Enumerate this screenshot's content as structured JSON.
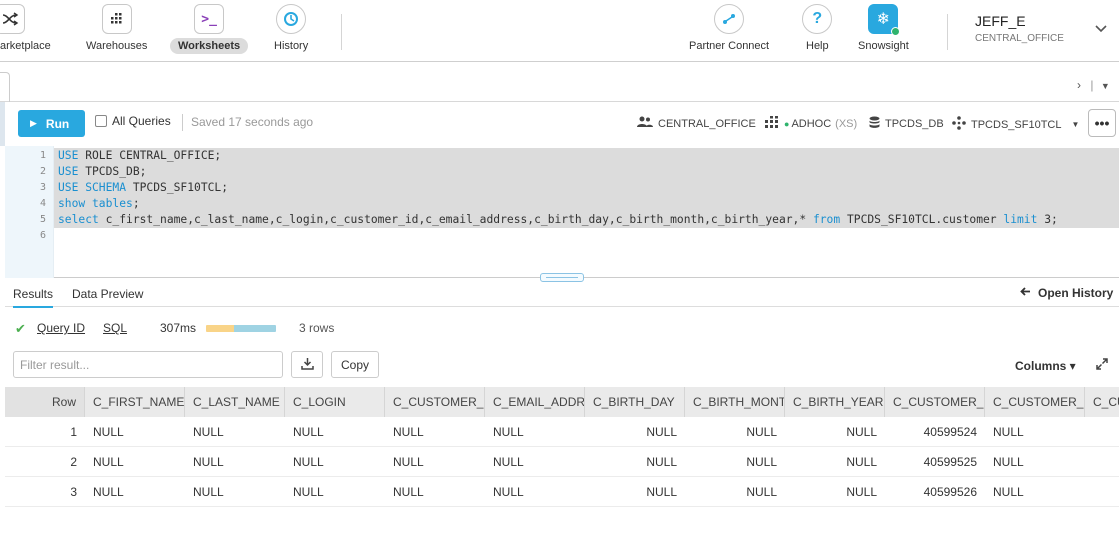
{
  "nav": {
    "items": [
      {
        "label": "arketplace",
        "icon": "marketplace-icon"
      },
      {
        "label": "Warehouses",
        "icon": "warehouses-icon"
      },
      {
        "label": "Worksheets",
        "icon": "worksheets-icon",
        "active": true
      },
      {
        "label": "History",
        "icon": "history-icon"
      }
    ],
    "right_items": [
      {
        "label": "Partner Connect",
        "icon": "partner-connect-icon"
      },
      {
        "label": "Help",
        "icon": "help-icon"
      },
      {
        "label": "Snowsight",
        "icon": "snowsight-icon"
      }
    ],
    "user_name": "JEFF_E",
    "user_role": "CENTRAL_OFFICE"
  },
  "toolbar": {
    "run_label": "Run",
    "all_queries_label": "All Queries",
    "all_queries_checked": false,
    "saved_text": "Saved 17 seconds ago",
    "role": "CENTRAL_OFFICE",
    "warehouse": "ADHOC",
    "warehouse_size": "(XS)",
    "database": "TPCDS_DB",
    "schema": "TPCDS_SF10TCL",
    "more_label": "•••"
  },
  "editor": {
    "line_numbers": [
      "1",
      "2",
      "3",
      "4",
      "5",
      "6"
    ],
    "lines": [
      [
        {
          "t": "USE",
          "k": true
        },
        {
          "t": " ROLE CENTRAL_OFFICE;"
        }
      ],
      [
        {
          "t": "USE",
          "k": true
        },
        {
          "t": " TPCDS_DB;"
        }
      ],
      [
        {
          "t": "USE SCHEMA",
          "k": true
        },
        {
          "t": " TPCDS_SF10TCL;"
        }
      ],
      [
        {
          "t": "show tables",
          "k": true
        },
        {
          "t": ";"
        }
      ],
      [
        {
          "t": "select",
          "k": true
        },
        {
          "t": " c_first_name,c_last_name,c_login,c_customer_id,c_email_address,c_birth_day,c_birth_month,c_birth_year,* "
        },
        {
          "t": "from",
          "k": true
        },
        {
          "t": " TPCDS_SF10TCL.customer "
        },
        {
          "t": "limit",
          "k": true
        },
        {
          "t": " 3;"
        }
      ],
      []
    ]
  },
  "results": {
    "tab_results": "Results",
    "tab_preview": "Data Preview",
    "open_history": "Open History",
    "query_id_label": "Query ID",
    "sql_label": "SQL",
    "duration": "307ms",
    "row_count": "3 rows",
    "filter_placeholder": "Filter result...",
    "copy_label": "Copy",
    "columns_label": "Columns ▾",
    "headers": [
      "Row",
      "C_FIRST_NAME",
      "C_LAST_NAME",
      "C_LOGIN",
      "C_CUSTOMER_I",
      "C_EMAIL_ADDRI",
      "C_BIRTH_DAY",
      "C_BIRTH_MONT",
      "C_BIRTH_YEAR..",
      "C_CUSTOMER_S",
      "C_CUSTOMER_I",
      "C_CU"
    ],
    "rows": [
      [
        "1",
        "NULL",
        "NULL",
        "NULL",
        "NULL",
        "NULL",
        "NULL",
        "NULL",
        "NULL",
        "40599524",
        "NULL",
        ""
      ],
      [
        "2",
        "NULL",
        "NULL",
        "NULL",
        "NULL",
        "NULL",
        "NULL",
        "NULL",
        "NULL",
        "40599525",
        "NULL",
        ""
      ],
      [
        "3",
        "NULL",
        "NULL",
        "NULL",
        "NULL",
        "NULL",
        "NULL",
        "NULL",
        "NULL",
        "40599526",
        "NULL",
        ""
      ]
    ]
  },
  "colors": {
    "accent": "#29a8df",
    "keyword": "#1a8fd0",
    "success": "#4caf50",
    "warehouse_running": "#2fb36d"
  }
}
